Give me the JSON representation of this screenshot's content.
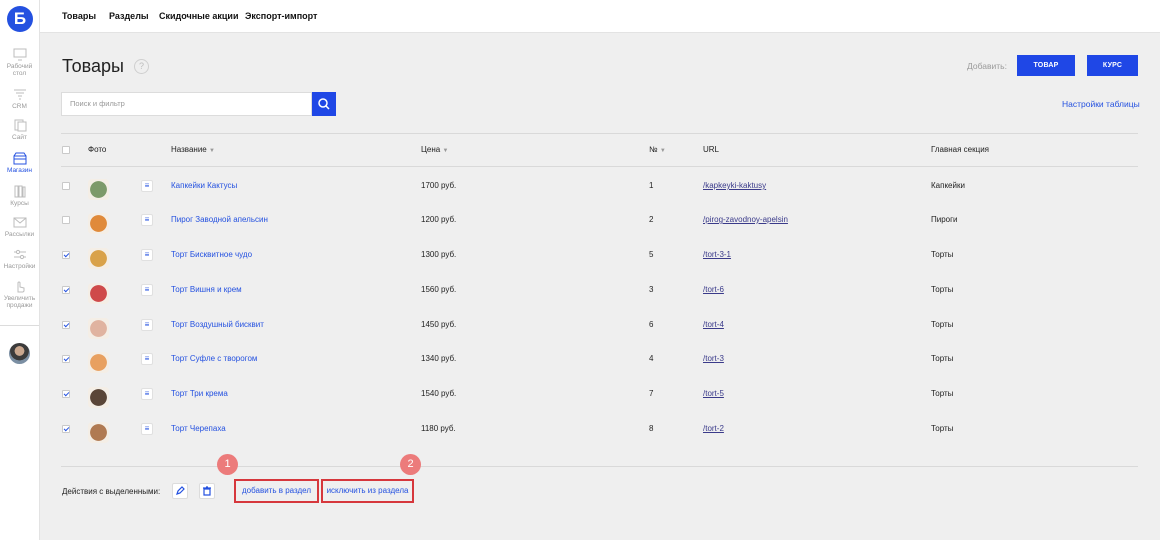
{
  "sidebar": {
    "logo": "Б",
    "items": [
      {
        "label": "Рабочий стол",
        "icon": "desktop-icon"
      },
      {
        "label": "CRM",
        "icon": "funnel-icon"
      },
      {
        "label": "Сайт",
        "icon": "pages-icon"
      },
      {
        "label": "Магазин",
        "icon": "shop-icon",
        "active": true
      },
      {
        "label": "Курсы",
        "icon": "courses-icon"
      },
      {
        "label": "Рассылки",
        "icon": "mail-icon"
      },
      {
        "label": "Настройки",
        "icon": "sliders-icon"
      },
      {
        "label": "Увеличить продажи",
        "icon": "hand-pointer-icon"
      }
    ]
  },
  "topnav": [
    "Товары",
    "Разделы",
    "Скидочные акции",
    "Экспорт-импорт"
  ],
  "page": {
    "title": "Товары",
    "help": "?",
    "add_label": "Добавить:",
    "btn_product": "ТОВАР",
    "btn_course": "КУРС",
    "search_placeholder": "Поиск и фильтр",
    "table_settings": "Настройки таблицы"
  },
  "table": {
    "headers": {
      "photo": "Фото",
      "name": "Название",
      "price": "Цена",
      "num": "№",
      "url": "URL",
      "section": "Главная секция"
    },
    "rows": [
      {
        "checked": false,
        "name": "Капкейки Кактусы",
        "price": "1700 руб.",
        "num": "1",
        "url": "/kapkeyki-kaktusy",
        "section": "Капкейки",
        "thumb": "#7d9a6a"
      },
      {
        "checked": false,
        "name": "Пирог Заводной апельсин",
        "price": "1200 руб.",
        "num": "2",
        "url": "/pirog-zavodnoy-apelsin",
        "section": "Пироги",
        "thumb": "#e08a3a"
      },
      {
        "checked": true,
        "name": "Торт Бисквитное чудо",
        "price": "1300 руб.",
        "num": "5",
        "url": "/tort-3-1",
        "section": "Торты",
        "thumb": "#d9a24a"
      },
      {
        "checked": true,
        "name": "Торт Вишня и крем",
        "price": "1560 руб.",
        "num": "3",
        "url": "/tort-6",
        "section": "Торты",
        "thumb": "#cf4a4a"
      },
      {
        "checked": true,
        "name": "Торт Воздушный бисквит",
        "price": "1450 руб.",
        "num": "6",
        "url": "/tort-4",
        "section": "Торты",
        "thumb": "#e0b3a0"
      },
      {
        "checked": true,
        "name": "Торт Суфле с творогом",
        "price": "1340 руб.",
        "num": "4",
        "url": "/tort-3",
        "section": "Торты",
        "thumb": "#e8a060"
      },
      {
        "checked": true,
        "name": "Торт Три крема",
        "price": "1540 руб.",
        "num": "7",
        "url": "/tort-5",
        "section": "Торты",
        "thumb": "#5a4638"
      },
      {
        "checked": true,
        "name": "Торт Черепаха",
        "price": "1180 руб.",
        "num": "8",
        "url": "/tort-2",
        "section": "Торты",
        "thumb": "#b07a52"
      }
    ]
  },
  "actions": {
    "label": "Действия с выделенными:",
    "add_to_section": "добавить в раздел",
    "remove_from_section": "исключить из раздела",
    "badge1": "1",
    "badge2": "2"
  },
  "colors": {
    "accent": "#1f47e6",
    "highlight": "#d6373c",
    "badge": "#ec7b7b"
  }
}
